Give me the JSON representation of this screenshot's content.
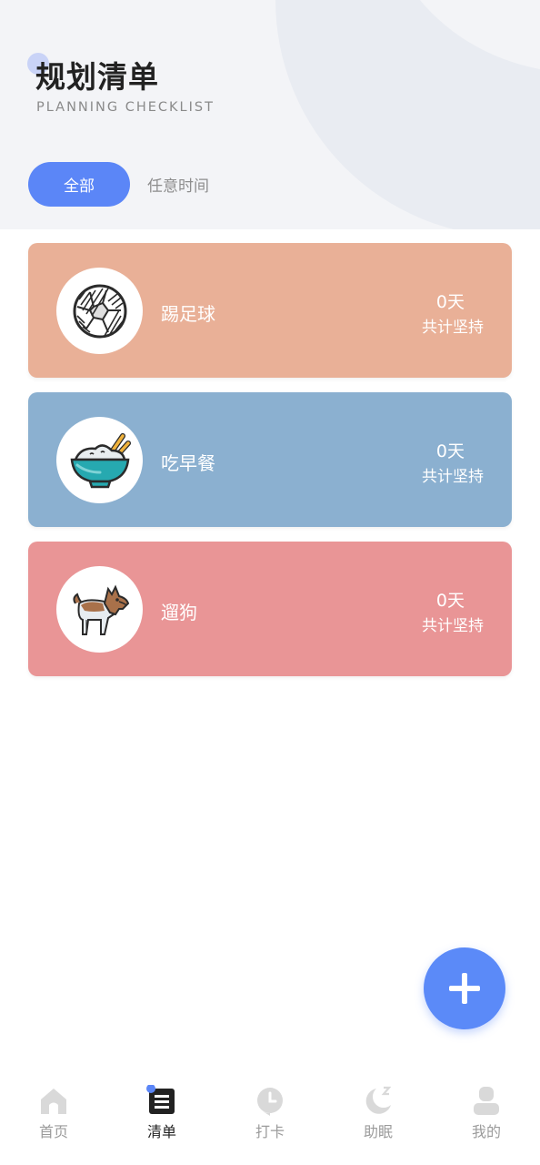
{
  "header": {
    "title": "规划清单",
    "subtitle": "PLANNING CHECKLIST"
  },
  "filters": {
    "all_label": "全部",
    "any_time_label": "任意时间"
  },
  "plans": [
    {
      "name": "踢足球",
      "days": "0天",
      "days_label": "共计坚持",
      "icon": "soccer-ball-icon",
      "color": "#e9b097"
    },
    {
      "name": "吃早餐",
      "days": "0天",
      "days_label": "共计坚持",
      "icon": "rice-bowl-icon",
      "color": "#8bb0d0"
    },
    {
      "name": "遛狗",
      "days": "0天",
      "days_label": "共计坚持",
      "icon": "dog-icon",
      "color": "#e99596"
    }
  ],
  "fab": {
    "icon": "plus-icon"
  },
  "nav": [
    {
      "label": "首页",
      "icon": "home-icon",
      "active": false
    },
    {
      "label": "清单",
      "icon": "list-icon",
      "active": true
    },
    {
      "label": "打卡",
      "icon": "clock-icon",
      "active": false
    },
    {
      "label": "助眠",
      "icon": "moon-icon",
      "active": false
    },
    {
      "label": "我的",
      "icon": "user-icon",
      "active": false
    }
  ],
  "colors": {
    "accent": "#5b86f7",
    "nav_inactive": "#d9d9d9",
    "nav_active": "#222222"
  }
}
